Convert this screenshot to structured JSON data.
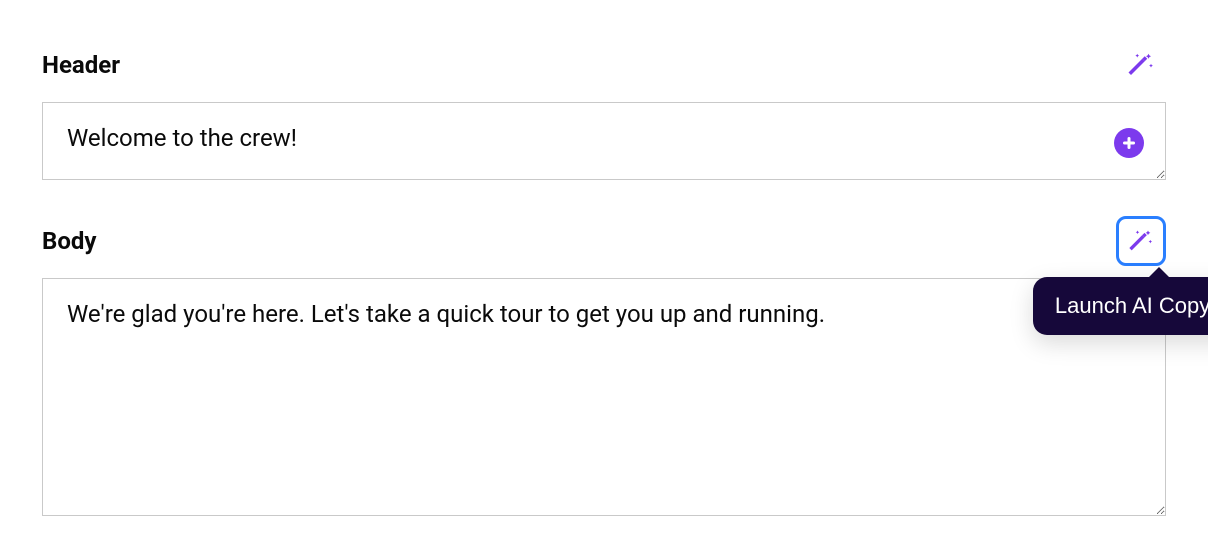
{
  "header": {
    "label": "Header",
    "value": "Welcome to the crew!"
  },
  "body": {
    "label": "Body",
    "value": "We're glad you're here. Let's take a quick tour to get you up and running."
  },
  "tooltip": "Launch AI Copywriter",
  "colors": {
    "accent": "#7c3aed",
    "tooltipBg": "#16083a",
    "focusRing": "#2a7fff"
  }
}
